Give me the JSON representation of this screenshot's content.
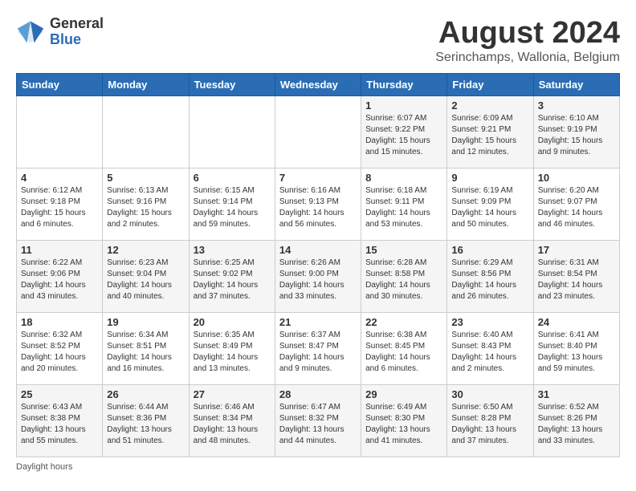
{
  "header": {
    "logo_general": "General",
    "logo_blue": "Blue",
    "title": "August 2024",
    "subtitle": "Serinchamps, Wallonia, Belgium"
  },
  "weekdays": [
    "Sunday",
    "Monday",
    "Tuesday",
    "Wednesday",
    "Thursday",
    "Friday",
    "Saturday"
  ],
  "weeks": [
    [
      {
        "day": "",
        "info": ""
      },
      {
        "day": "",
        "info": ""
      },
      {
        "day": "",
        "info": ""
      },
      {
        "day": "",
        "info": ""
      },
      {
        "day": "1",
        "info": "Sunrise: 6:07 AM\nSunset: 9:22 PM\nDaylight: 15 hours\nand 15 minutes."
      },
      {
        "day": "2",
        "info": "Sunrise: 6:09 AM\nSunset: 9:21 PM\nDaylight: 15 hours\nand 12 minutes."
      },
      {
        "day": "3",
        "info": "Sunrise: 6:10 AM\nSunset: 9:19 PM\nDaylight: 15 hours\nand 9 minutes."
      }
    ],
    [
      {
        "day": "4",
        "info": "Sunrise: 6:12 AM\nSunset: 9:18 PM\nDaylight: 15 hours\nand 6 minutes."
      },
      {
        "day": "5",
        "info": "Sunrise: 6:13 AM\nSunset: 9:16 PM\nDaylight: 15 hours\nand 2 minutes."
      },
      {
        "day": "6",
        "info": "Sunrise: 6:15 AM\nSunset: 9:14 PM\nDaylight: 14 hours\nand 59 minutes."
      },
      {
        "day": "7",
        "info": "Sunrise: 6:16 AM\nSunset: 9:13 PM\nDaylight: 14 hours\nand 56 minutes."
      },
      {
        "day": "8",
        "info": "Sunrise: 6:18 AM\nSunset: 9:11 PM\nDaylight: 14 hours\nand 53 minutes."
      },
      {
        "day": "9",
        "info": "Sunrise: 6:19 AM\nSunset: 9:09 PM\nDaylight: 14 hours\nand 50 minutes."
      },
      {
        "day": "10",
        "info": "Sunrise: 6:20 AM\nSunset: 9:07 PM\nDaylight: 14 hours\nand 46 minutes."
      }
    ],
    [
      {
        "day": "11",
        "info": "Sunrise: 6:22 AM\nSunset: 9:06 PM\nDaylight: 14 hours\nand 43 minutes."
      },
      {
        "day": "12",
        "info": "Sunrise: 6:23 AM\nSunset: 9:04 PM\nDaylight: 14 hours\nand 40 minutes."
      },
      {
        "day": "13",
        "info": "Sunrise: 6:25 AM\nSunset: 9:02 PM\nDaylight: 14 hours\nand 37 minutes."
      },
      {
        "day": "14",
        "info": "Sunrise: 6:26 AM\nSunset: 9:00 PM\nDaylight: 14 hours\nand 33 minutes."
      },
      {
        "day": "15",
        "info": "Sunrise: 6:28 AM\nSunset: 8:58 PM\nDaylight: 14 hours\nand 30 minutes."
      },
      {
        "day": "16",
        "info": "Sunrise: 6:29 AM\nSunset: 8:56 PM\nDaylight: 14 hours\nand 26 minutes."
      },
      {
        "day": "17",
        "info": "Sunrise: 6:31 AM\nSunset: 8:54 PM\nDaylight: 14 hours\nand 23 minutes."
      }
    ],
    [
      {
        "day": "18",
        "info": "Sunrise: 6:32 AM\nSunset: 8:52 PM\nDaylight: 14 hours\nand 20 minutes."
      },
      {
        "day": "19",
        "info": "Sunrise: 6:34 AM\nSunset: 8:51 PM\nDaylight: 14 hours\nand 16 minutes."
      },
      {
        "day": "20",
        "info": "Sunrise: 6:35 AM\nSunset: 8:49 PM\nDaylight: 14 hours\nand 13 minutes."
      },
      {
        "day": "21",
        "info": "Sunrise: 6:37 AM\nSunset: 8:47 PM\nDaylight: 14 hours\nand 9 minutes."
      },
      {
        "day": "22",
        "info": "Sunrise: 6:38 AM\nSunset: 8:45 PM\nDaylight: 14 hours\nand 6 minutes."
      },
      {
        "day": "23",
        "info": "Sunrise: 6:40 AM\nSunset: 8:43 PM\nDaylight: 14 hours\nand 2 minutes."
      },
      {
        "day": "24",
        "info": "Sunrise: 6:41 AM\nSunset: 8:40 PM\nDaylight: 13 hours\nand 59 minutes."
      }
    ],
    [
      {
        "day": "25",
        "info": "Sunrise: 6:43 AM\nSunset: 8:38 PM\nDaylight: 13 hours\nand 55 minutes."
      },
      {
        "day": "26",
        "info": "Sunrise: 6:44 AM\nSunset: 8:36 PM\nDaylight: 13 hours\nand 51 minutes."
      },
      {
        "day": "27",
        "info": "Sunrise: 6:46 AM\nSunset: 8:34 PM\nDaylight: 13 hours\nand 48 minutes."
      },
      {
        "day": "28",
        "info": "Sunrise: 6:47 AM\nSunset: 8:32 PM\nDaylight: 13 hours\nand 44 minutes."
      },
      {
        "day": "29",
        "info": "Sunrise: 6:49 AM\nSunset: 8:30 PM\nDaylight: 13 hours\nand 41 minutes."
      },
      {
        "day": "30",
        "info": "Sunrise: 6:50 AM\nSunset: 8:28 PM\nDaylight: 13 hours\nand 37 minutes."
      },
      {
        "day": "31",
        "info": "Sunrise: 6:52 AM\nSunset: 8:26 PM\nDaylight: 13 hours\nand 33 minutes."
      }
    ]
  ],
  "footer": "Daylight hours"
}
